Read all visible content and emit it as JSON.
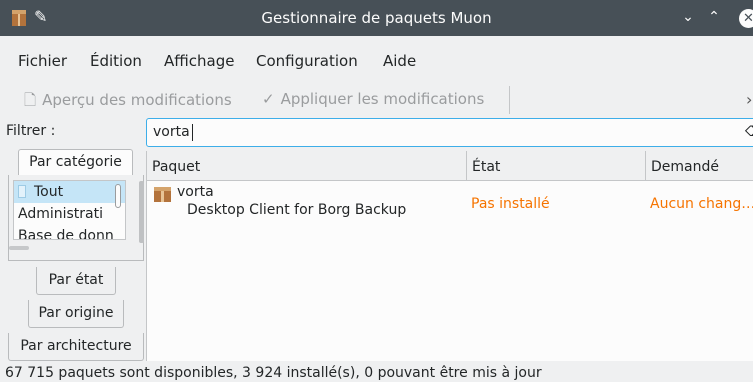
{
  "window": {
    "title": "Gestionnaire de paquets Muon",
    "minimize_glyph": "⌄",
    "maximize_glyph": "⌃",
    "close_glyph": "✕"
  },
  "menu": [
    "Fichier",
    "Édition",
    "Affichage",
    "Configuration",
    "Aide"
  ],
  "toolbar": {
    "preview_label": "Aperçu des modifications",
    "apply_label": "Appliquer les modifications",
    "overflow_glyph": "›"
  },
  "filter": {
    "label": "Filtrer :",
    "value": "vorta"
  },
  "sidebar": {
    "category_tab": "Par catégorie",
    "categories": [
      "Tout",
      "Administrati",
      "Base de donn"
    ],
    "state_tab": "Par état",
    "origin_tab": "Par origine",
    "arch_tab": "Par architecture"
  },
  "table": {
    "columns": [
      "Paquet",
      "État",
      "Demandé"
    ],
    "rows": [
      {
        "name": "vorta",
        "description": "Desktop Client for Borg Backup",
        "state": "Pas installé",
        "requested": "Aucun chang…"
      }
    ]
  },
  "status": "67 715 paquets sont disponibles, 3 924 installé(s), 0 pouvant être mis à jour",
  "colors": {
    "titlebar": "#475057",
    "accent": "#3daee9",
    "warning_text": "#f67400",
    "selection": "#c5e5f7"
  },
  "icons": {
    "app": "package-box-icon",
    "pin": "pin-icon",
    "preview": "document-preview-icon",
    "apply": "checkmark-icon",
    "clear": "clear-text-icon"
  }
}
